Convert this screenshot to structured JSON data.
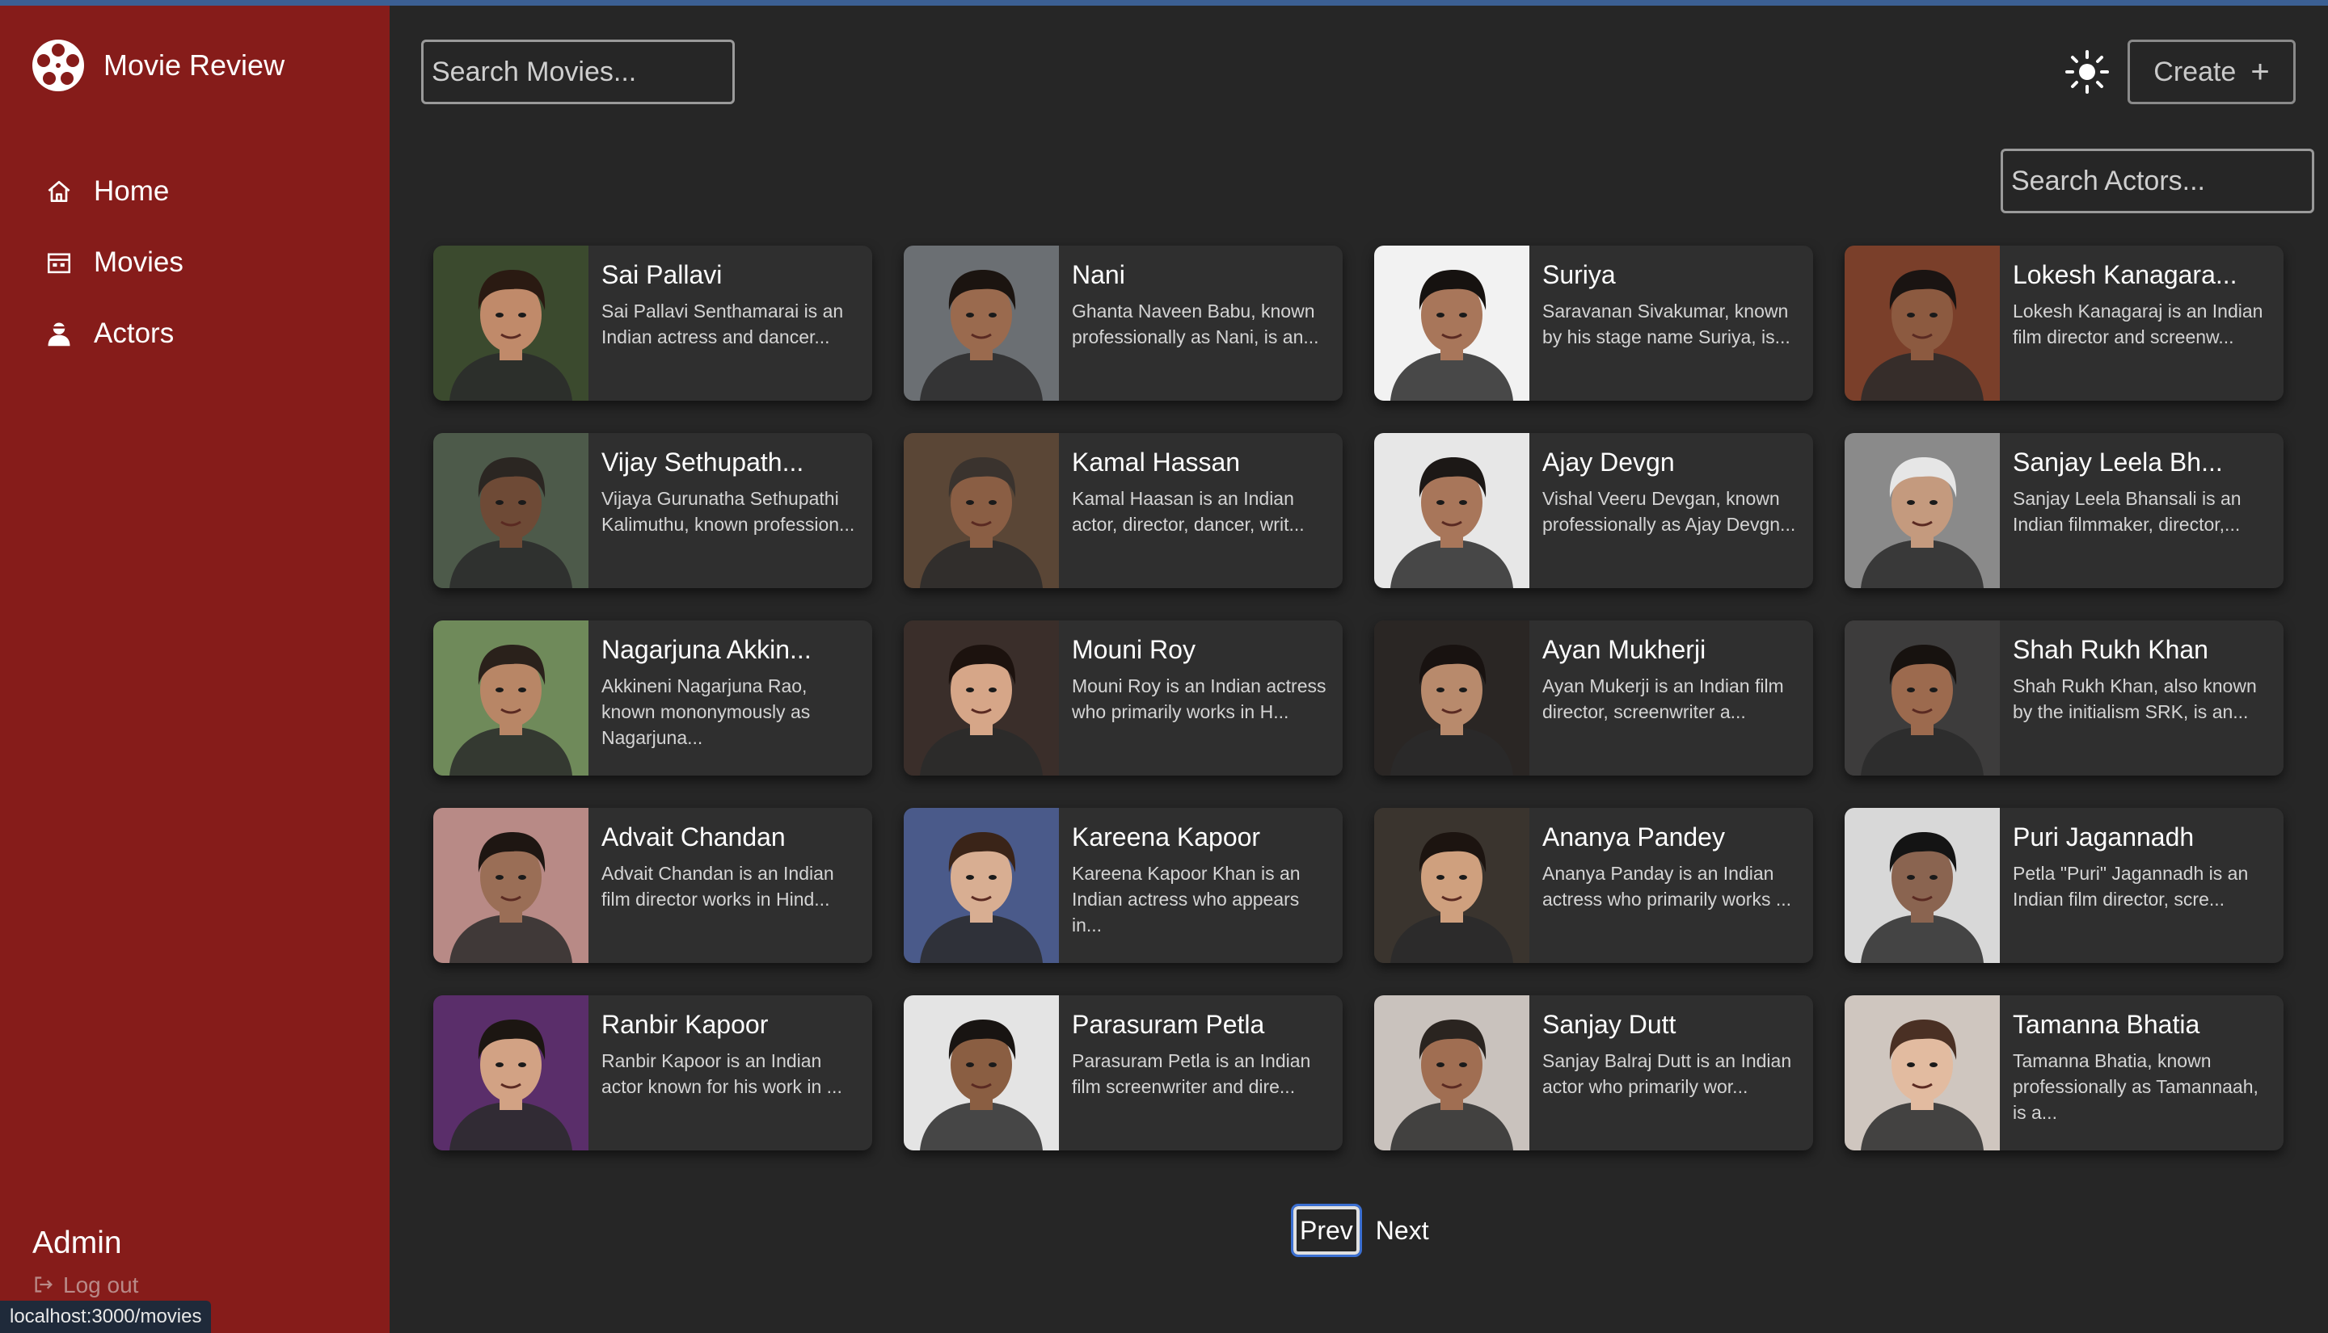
{
  "app": {
    "name": "Movie Review"
  },
  "sidebar": {
    "items": [
      {
        "label": "Home",
        "icon": "home-icon"
      },
      {
        "label": "Movies",
        "icon": "film-icon"
      },
      {
        "label": "Actors",
        "icon": "user-icon"
      }
    ],
    "user": "Admin",
    "logout_label": "Log out"
  },
  "browser_status_url": "localhost:3000/movies",
  "header": {
    "search_movies_placeholder": "Search Movies...",
    "create_label": "Create",
    "theme_icon": "sun-icon"
  },
  "actors_search_placeholder": "Search Actors...",
  "actors": [
    {
      "name": "Sai Pallavi",
      "bio": "Sai Pallavi Senthamarai is an Indian actress and dancer...",
      "bg": "#3b4a2e",
      "skin": "#c08a6a",
      "hair": "#2a1a12"
    },
    {
      "name": "Nani",
      "bio": "Ghanta Naveen Babu, known professionally as Nani, is an...",
      "bg": "#6b6f73",
      "skin": "#9a6a4e",
      "hair": "#1b1410"
    },
    {
      "name": "Suriya",
      "bio": "Saravanan Sivakumar, known by his stage name Suriya, is...",
      "bg": "#f2f2f2",
      "skin": "#a8765a",
      "hair": "#161210"
    },
    {
      "name": "Lokesh Kanagara...",
      "bio": "Lokesh Kanagaraj is an Indian film director and screenw...",
      "bg": "#7a3f2a",
      "skin": "#8c5a40",
      "hair": "#1a1412"
    },
    {
      "name": "Vijay Sethupath...",
      "bio": "Vijaya Gurunatha Sethupathi Kalimuthu, known profession...",
      "bg": "#4d5a4a",
      "skin": "#6e4a36",
      "hair": "#2b2622"
    },
    {
      "name": "Kamal Hassan",
      "bio": "Kamal Haasan is an Indian actor, director, dancer, writ...",
      "bg": "#5a4636",
      "skin": "#8a5e44",
      "hair": "#3a332e"
    },
    {
      "name": "Ajay Devgn",
      "bio": "Vishal Veeru Devgan, known professionally as Ajay Devgn...",
      "bg": "#e7e7e7",
      "skin": "#a8765a",
      "hair": "#1c1816"
    },
    {
      "name": "Sanjay Leela Bh...",
      "bio": "Sanjay Leela Bhansali is an Indian filmmaker, director,...",
      "bg": "#8a8a8a",
      "skin": "#c49a7e",
      "hair": "#e6e6e6"
    },
    {
      "name": "Nagarjuna Akkin...",
      "bio": "Akkineni Nagarjuna Rao, known mononymously as Nagarjuna...",
      "bg": "#6f8a5a",
      "skin": "#b88666",
      "hair": "#2a211b"
    },
    {
      "name": "Mouni Roy",
      "bio": "Mouni Roy is an Indian actress who primarily works in H...",
      "bg": "#3a2e2a",
      "skin": "#d6a688",
      "hair": "#1c120e"
    },
    {
      "name": "Ayan Mukherji",
      "bio": "Ayan Mukerji is an Indian film director, screenwriter a...",
      "bg": "#2a2624",
      "skin": "#b88a6c",
      "hair": "#181210"
    },
    {
      "name": "Shah Rukh Khan",
      "bio": "Shah Rukh Khan, also known by the initialism SRK, is an...",
      "bg": "#3d3c3c",
      "skin": "#9c6a4e",
      "hair": "#17120f"
    },
    {
      "name": "Advait Chandan",
      "bio": "Advait Chandan is an Indian film director works in Hind...",
      "bg": "#b88a86",
      "skin": "#9a6e56",
      "hair": "#1e1612"
    },
    {
      "name": "Kareena Kapoor",
      "bio": "Kareena Kapoor Khan is an Indian actress who appears in...",
      "bg": "#4a5a8a",
      "skin": "#d8ae92",
      "hair": "#3a2418"
    },
    {
      "name": "Ananya Pandey",
      "bio": "Ananya Panday is an Indian actress who primarily works ...",
      "bg": "#3a342e",
      "skin": "#cfa07e",
      "hair": "#1c1410"
    },
    {
      "name": "Puri Jagannadh",
      "bio": "Petla \"Puri\" Jagannadh is an Indian film director, scre...",
      "bg": "#d8d8d8",
      "skin": "#8a6450",
      "hair": "#141414"
    },
    {
      "name": "Ranbir Kapoor",
      "bio": "Ranbir Kapoor is an Indian actor known for his work in ...",
      "bg": "#5a2e6a",
      "skin": "#d2a284",
      "hair": "#1c1612"
    },
    {
      "name": "Parasuram Petla",
      "bio": "Parasuram Petla is an Indian film screenwriter and dire...",
      "bg": "#e4e4e4",
      "skin": "#8a5e42",
      "hair": "#181412"
    },
    {
      "name": "Sanjay Dutt",
      "bio": "Sanjay Balraj Dutt is an Indian actor who primarily wor...",
      "bg": "#c9c2bd",
      "skin": "#a06e52",
      "hair": "#2a2420"
    },
    {
      "name": "Tamanna Bhatia",
      "bio": "Tamanna Bhatia, known professionally as Tamannaah, is a...",
      "bg": "#cfc6bf",
      "skin": "#e2bba0",
      "hair": "#4a3024"
    }
  ],
  "pagination": {
    "prev_label": "Prev",
    "next_label": "Next"
  },
  "colors": {
    "sidebar": "#861c1a",
    "background": "#262626",
    "card": "#2f2f2f"
  }
}
